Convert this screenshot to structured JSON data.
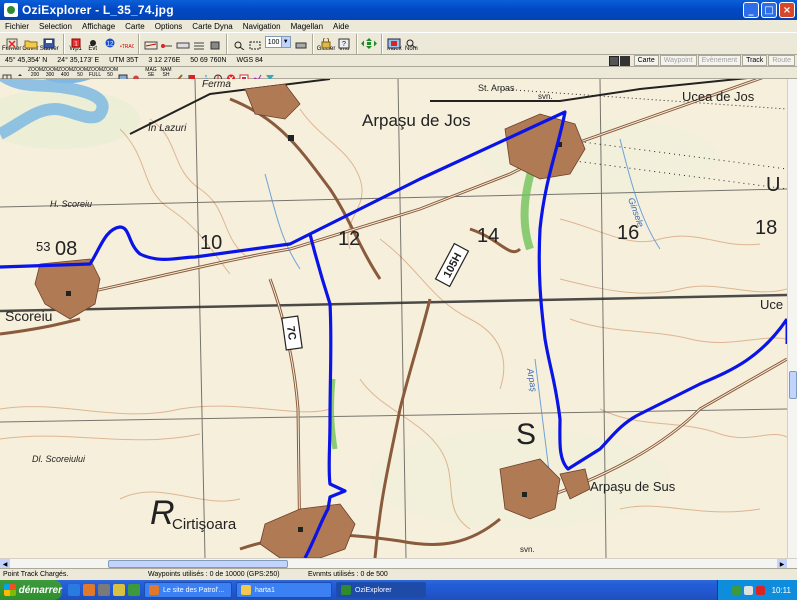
{
  "window": {
    "title": "OziExplorer  -  L_35_74.jpg",
    "minimize": "_",
    "maximize": "□",
    "close": "×"
  },
  "menu": [
    "Fichier",
    "Selection",
    "Affichage",
    "Carte",
    "Options",
    "Carte Dyna",
    "Navigation",
    "Magellan",
    "Aide"
  ],
  "toolbar": {
    "fermer": "Fermer",
    "ouvrir": "Ouvrir",
    "sauver": "Sauver",
    "wp1": "Wp1",
    "evt": "Evt",
    "glisser": "Glisser",
    "info": "Info",
    "index": "Index",
    "nom": "Nom",
    "zoom": "100"
  },
  "infobar": {
    "lat": "45° 45,354' N",
    "lon": "24° 35,173' E",
    "utm": "UTM  35T",
    "easting": "3 12 276E",
    "northing": "50 69 760N",
    "datum": "WGS 84",
    "buttons": [
      "Carte",
      "Waypoint",
      "Evènement",
      "Track",
      "Route"
    ]
  },
  "tools2": [
    "ZOOM 200",
    "ZOOM 300",
    "ZOOM 400",
    "ZOOM 50",
    "ZOOM FULL",
    "ZOOM 50",
    "MAG SE",
    "NAM SH"
  ],
  "map": {
    "labels": {
      "ferma": "Ferma",
      "stArpas": "St. Arpas",
      "svn_top": "svn.",
      "uceaDeJos": "Ucea de Jos",
      "inLazuri": "În Lazuri",
      "arpasuDeJos": "Arpaşu de Jos",
      "ginsele": "Ginsele",
      "hScoreiu": "H. Scoreiu",
      "n53": "53",
      "n08": "08",
      "n10": "10",
      "n12": "12",
      "n14": "14",
      "n16": "16",
      "n18": "18",
      "u": "U",
      "road105H": "105H",
      "road7C": "7C",
      "scoreiu": "Scoreiu",
      "uce": "Uce",
      "arpas": "Arpaş",
      "bS": "S",
      "diScoreiului": "Dl. Scoreiului",
      "arpasuDeSus": "Arpaşu de Sus",
      "bigR": "R",
      "cirtisoara": "Cirtişoara",
      "svn_bottom": "svn."
    }
  },
  "statusbar": {
    "left": "Point Track Chargés.",
    "waypoints": "Waypoints utilisés : 0 de 10000  (GPS:250)",
    "evenements": "Evnmts utilisés : 0 de 500"
  },
  "taskbar": {
    "start": "démarrer",
    "tasks": [
      "Le site des Patrol'...",
      "harta1",
      "OziExplorer"
    ],
    "clock": "10:11"
  },
  "colors": {
    "track": "#0a14e6",
    "settlement": "#b07a55",
    "road": "#8a5a3c",
    "water": "#86bfe8"
  }
}
